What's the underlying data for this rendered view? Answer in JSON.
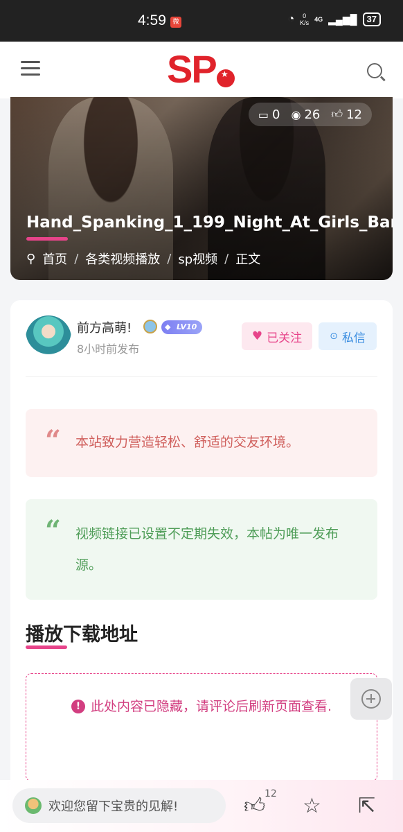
{
  "status_bar": {
    "time": "4:59",
    "app_icon_text": "微",
    "speed_value": "0",
    "speed_unit": "K/s",
    "network": "4G",
    "battery": "37"
  },
  "header": {
    "logo_text": "SP"
  },
  "hero": {
    "stats": {
      "comments": "0",
      "views": "26",
      "likes": "12"
    },
    "title": "Hand_Spanking_1_199_Night_At_Girls_Bar",
    "breadcrumb": [
      "首页",
      "各类视频播放",
      "sp视频",
      "正文"
    ]
  },
  "author": {
    "name": "前方高萌!",
    "level": "LV10",
    "post_time": "8小时前发布",
    "follow_label": "已关注",
    "message_label": "私信"
  },
  "quotes": {
    "notice_red": "本站致力营造轻松、舒适的交友环境。",
    "notice_green": "视频链接已设置不定期失效，本帖为唯一发布源。"
  },
  "download": {
    "section_title": "播放下载地址",
    "hidden_notice": "此处内容已隐藏，请评论后刷新页面查看."
  },
  "bottom_bar": {
    "comment_placeholder": "欢迎您留下宝贵的见解!",
    "like_count": "12"
  },
  "colors": {
    "brand_red": "#e0232b",
    "accent_pink": "#e7448a",
    "follow_bg": "#fde8ef",
    "message_blue": "#3a8de0"
  },
  "icons": [
    "menu-icon",
    "search-icon",
    "comment-icon",
    "eye-icon",
    "thumbs-up-icon",
    "location-pin-icon",
    "heart-icon",
    "chat-icon",
    "quote-icon",
    "warning-icon",
    "add-circle-icon",
    "star-icon",
    "share-icon"
  ]
}
